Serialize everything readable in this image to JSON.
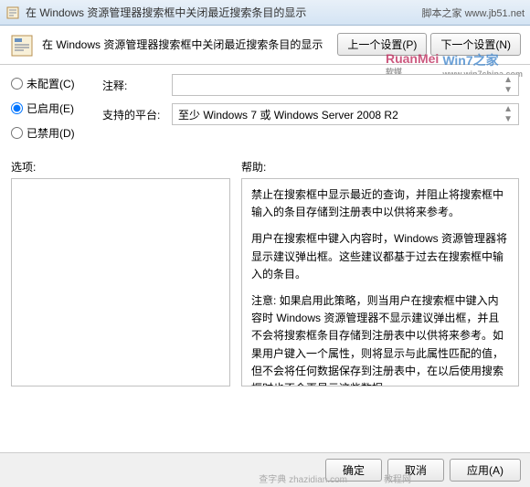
{
  "title": "在 Windows 资源管理器搜索框中关闭最近搜索条目的显示",
  "watermark_top": "脚本之家  www.jb51.net",
  "ribbon_title": "在 Windows 资源管理器搜索框中关闭最近搜索条目的显示",
  "btn_prev": "上一个设置(P)",
  "btn_next": "下一个设置(N)",
  "radios": {
    "unconfigured": "未配置(C)",
    "enabled": "已启用(E)",
    "disabled": "已禁用(D)"
  },
  "labels": {
    "comment": "注释:",
    "platform": "支持的平台:",
    "options": "选项:",
    "help": "帮助:"
  },
  "platform_value": "至少 Windows 7 或 Windows Server 2008 R2",
  "help": {
    "p1": "禁止在搜索框中显示最近的查询，并阻止将搜索框中输入的条目存储到注册表中以供将来参考。",
    "p2": "用户在搜索框中键入内容时，Windows 资源管理器将显示建议弹出框。这些建议都基于过去在搜索框中输入的条目。",
    "p3": "注意: 如果启用此策略，则当用户在搜索框中键入内容时 Windows 资源管理器不显示建议弹出框，并且不会将搜索框条目存储到注册表中以供将来参考。如果用户键入一个属性，则将显示与此属性匹配的值，但不会将任何数据保存到注册表中，在以后使用搜索框时也不会再显示这些数据。"
  },
  "footer": {
    "ok": "确定",
    "cancel": "取消",
    "apply": "应用(A)"
  },
  "wm_logos": {
    "ruanmei": "RuanMei",
    "ruanmei_sub": "软媒",
    "win7": "Win7之家",
    "win7_sub": "www.win7china.com"
  },
  "wm_bottom1": "教程网",
  "wm_bottom2": "查字典  zhazidian.com"
}
